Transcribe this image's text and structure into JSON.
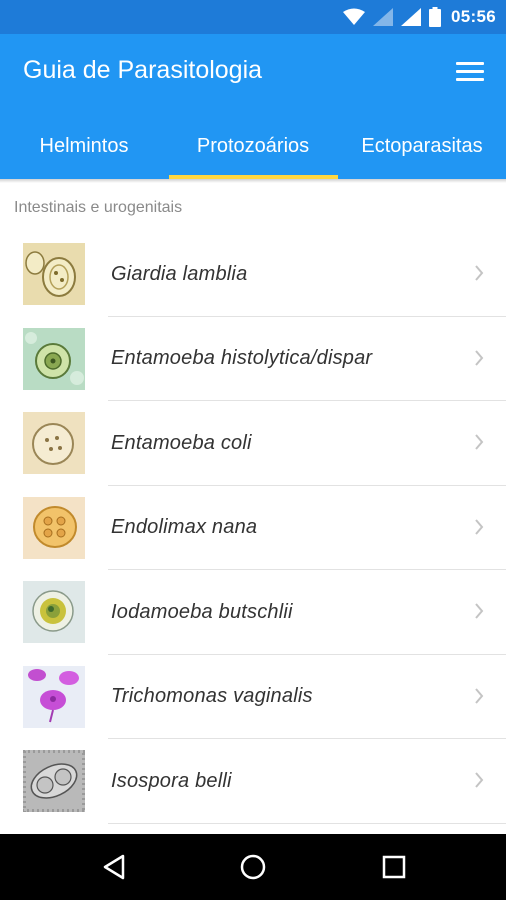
{
  "status_bar": {
    "time": "05:56"
  },
  "app_bar": {
    "title": "Guia de Parasitologia"
  },
  "tabs": [
    {
      "label": "Helmintos",
      "selected": false
    },
    {
      "label": "Protozoários",
      "selected": true
    },
    {
      "label": "Ectoparasitas",
      "selected": false
    }
  ],
  "section": {
    "label": "Intestinais e urogenitais"
  },
  "items": [
    {
      "name": "Giardia lamblia"
    },
    {
      "name": "Entamoeba histolytica/dispar"
    },
    {
      "name": "Entamoeba coli"
    },
    {
      "name": "Endolimax nana"
    },
    {
      "name": "Iodamoeba butschlii"
    },
    {
      "name": "Trichomonas vaginalis"
    },
    {
      "name": "Isospora belli"
    }
  ],
  "colors": {
    "status_bar": "#1e7bd8",
    "app_bar": "#2196f3",
    "tab_indicator": "#ffd740",
    "nav_bar": "#000000"
  },
  "icons": {
    "menu": "hamburger-menu-icon",
    "chevron": "chevron-right-icon",
    "nav": [
      "back-triangle-icon",
      "home-circle-icon",
      "recents-square-icon"
    ]
  }
}
